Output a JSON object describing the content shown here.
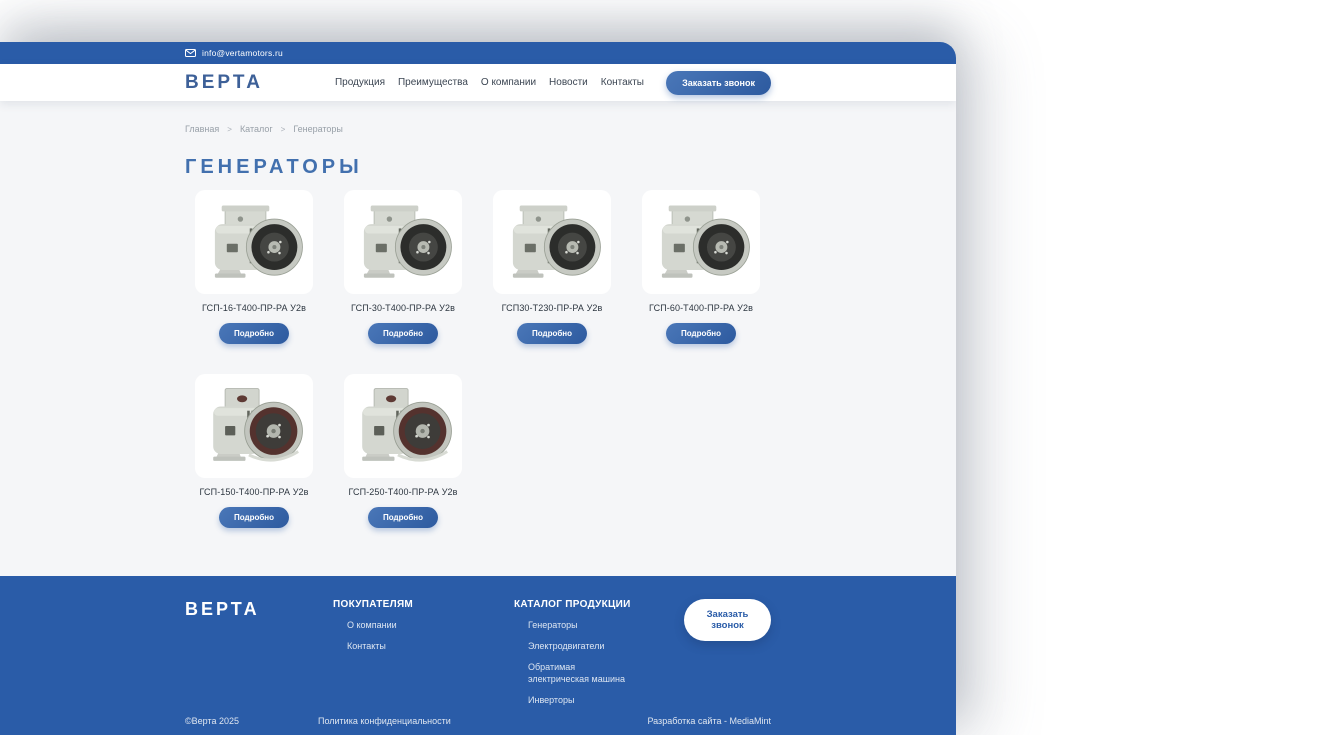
{
  "topbar": {
    "email": "info@vertamotors.ru"
  },
  "header": {
    "logo": "ВЕРТА",
    "nav": [
      "Продукция",
      "Преимущества",
      "О компании",
      "Новости",
      "Контакты"
    ],
    "call_button_label": "Заказать звонок"
  },
  "breadcrumb": {
    "items": [
      "Главная",
      "Каталог",
      "Генераторы"
    ],
    "separator": ">"
  },
  "catalog": {
    "title": "ГЕНЕРАТОРЫ",
    "detail_button": "Подробно",
    "products": [
      {
        "name": "ГСП-16-Т400-ПР-РА У2в"
      },
      {
        "name": "ГСП-30-Т400-ПР-РА У2в"
      },
      {
        "name": "ГСП30-Т230-ПР-РА У2в"
      },
      {
        "name": "ГСП-60-Т400-ПР-РА У2в"
      },
      {
        "name": "ГСП-150-Т400-ПР-РА У2в"
      },
      {
        "name": "ГСП-250-Т400-ПР-РА У2в"
      }
    ]
  },
  "footer": {
    "logo": "ВЕРТА",
    "call_button_label": "Заказать звонок",
    "columns": [
      {
        "heading": "ПОКУПАТЕЛЯМ",
        "links": [
          "О компании",
          "Контакты"
        ]
      },
      {
        "heading": "КАТАЛОГ ПРОДУКЦИИ",
        "links": [
          "Генераторы",
          "Электродвигатели",
          "Обратимая электрическая машина",
          "Инверторы"
        ]
      }
    ],
    "bottom": {
      "copyright": "©Верта 2025",
      "privacy": "Политика конфиденциальности",
      "developer": "Разработка сайта - MediaMint"
    }
  },
  "colors": {
    "brand_blue": "#2a5ca8",
    "logo_blue": "#3d6098",
    "title_blue": "#4270ae",
    "body_background": "#f5f6f8",
    "card_background": "#ffffff",
    "footer_link": "#dde6f2"
  }
}
